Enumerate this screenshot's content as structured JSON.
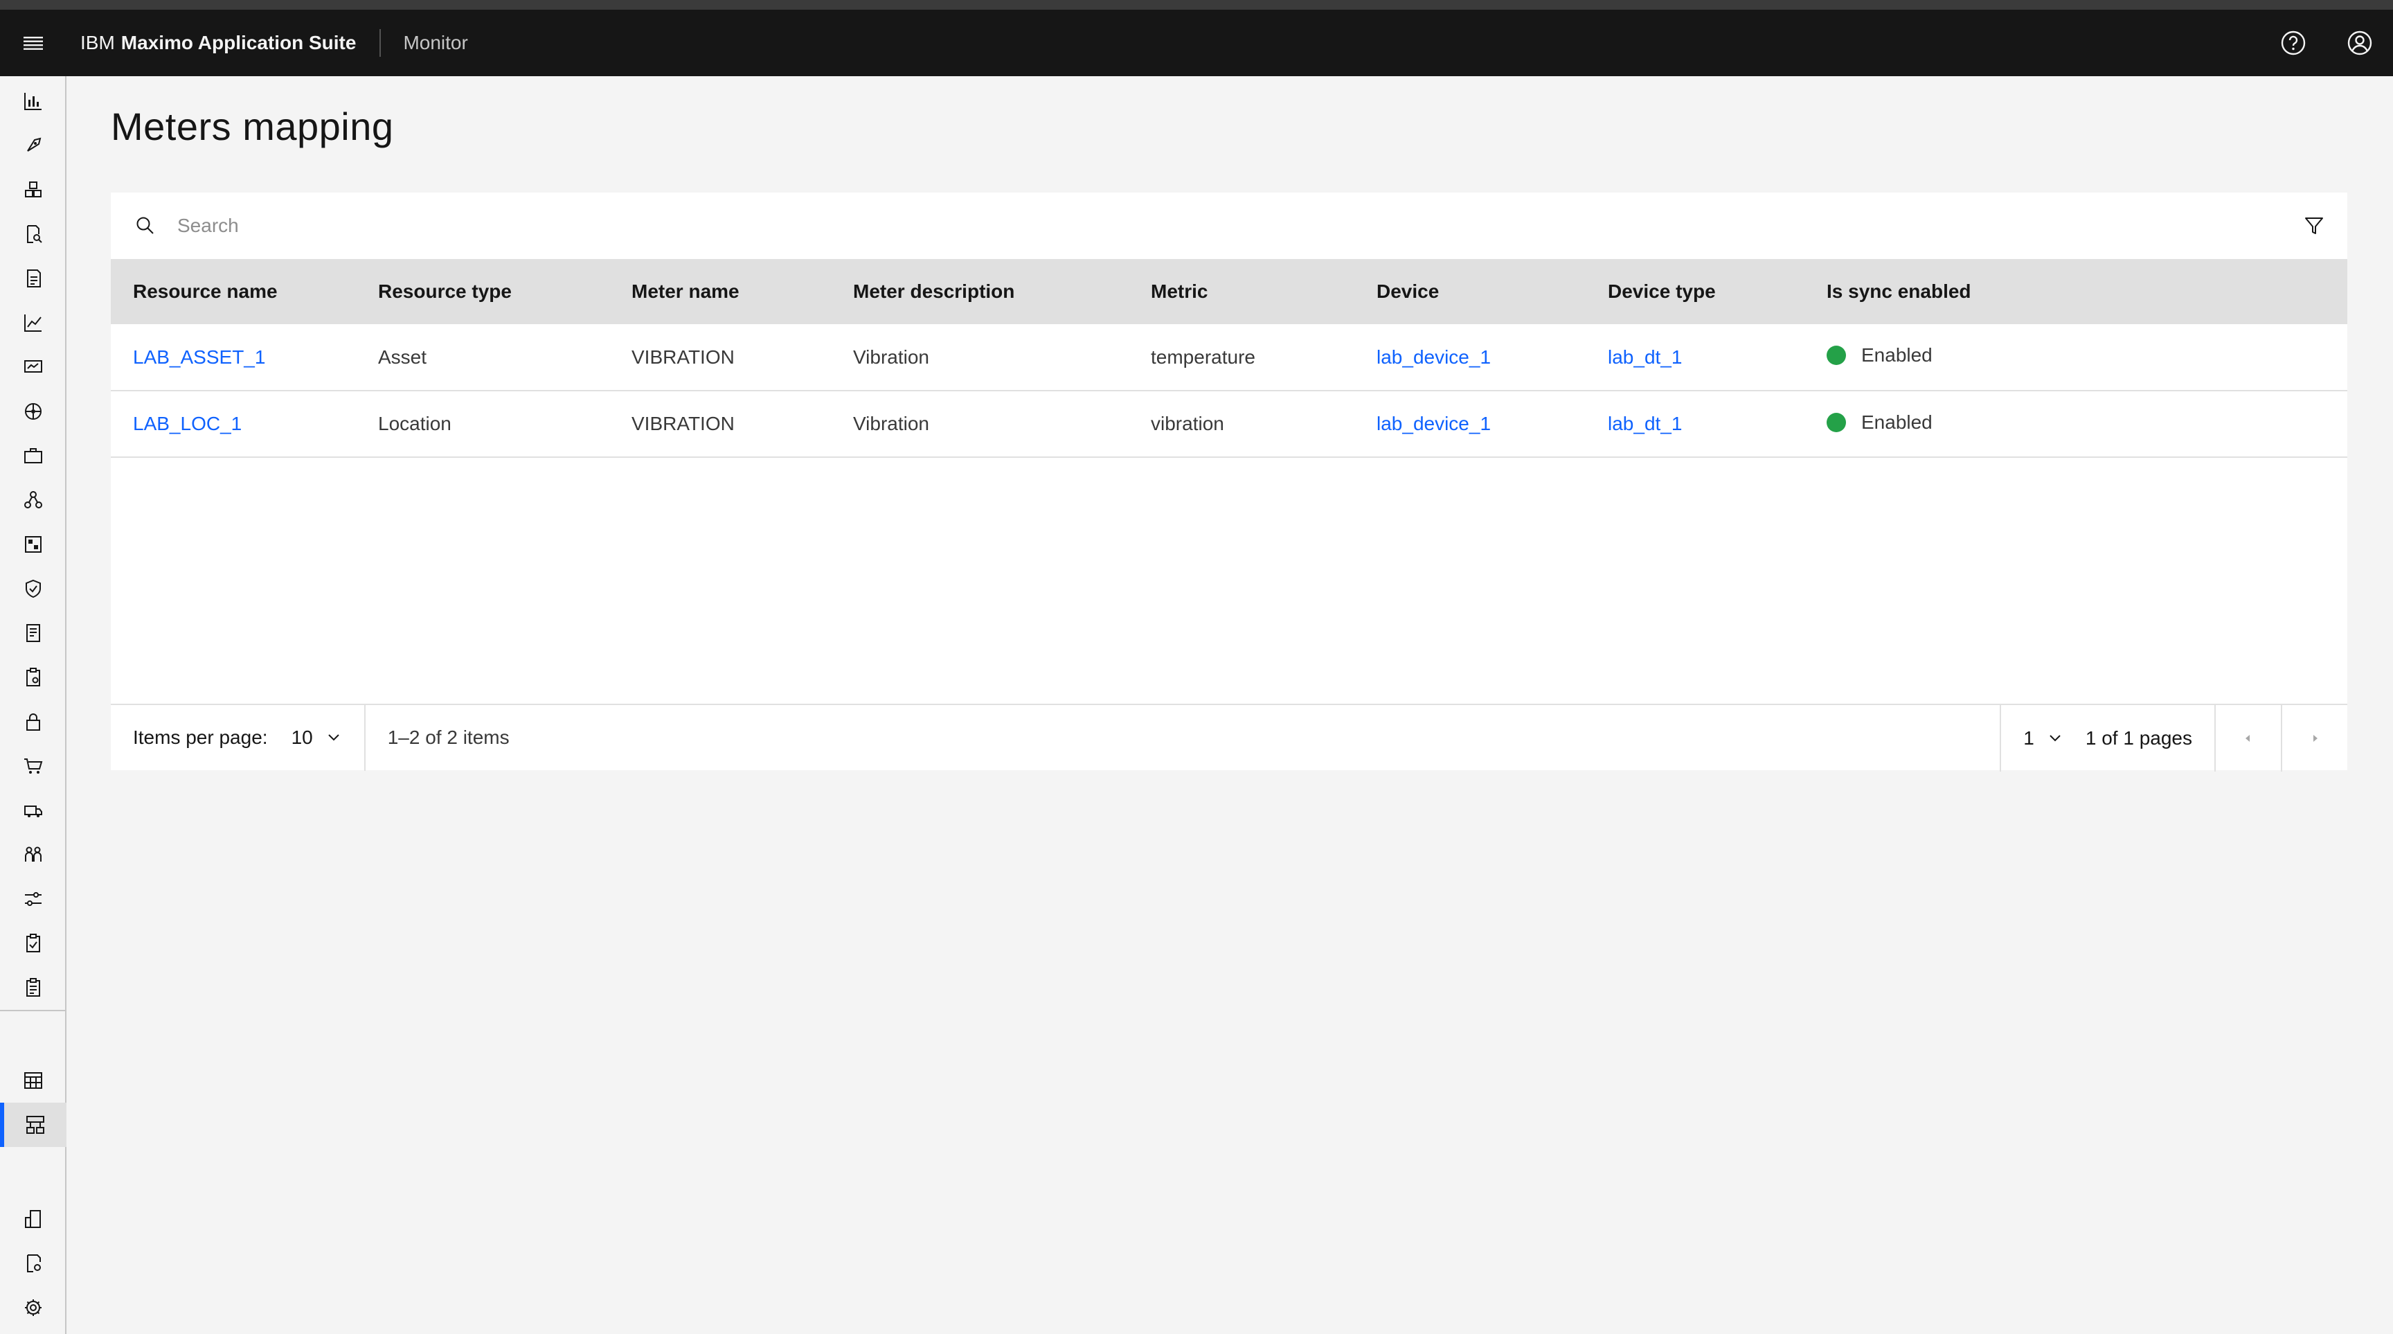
{
  "header": {
    "brand_prefix": "IBM",
    "brand_product": "Maximo Application Suite",
    "app_name": "Monitor",
    "icons": [
      "menu-icon",
      "help-icon",
      "user-avatar-icon"
    ]
  },
  "sidenav": {
    "active_item": "nav-item-meters-mapping",
    "accent_color": "#0f62fe"
  },
  "page": {
    "title": "Meters mapping"
  },
  "search": {
    "placeholder": "Search"
  },
  "table": {
    "columns": [
      "Resource name",
      "Resource type",
      "Meter name",
      "Meter description",
      "Metric",
      "Device",
      "Device type",
      "Is sync enabled"
    ],
    "rows": [
      {
        "resource_name": "LAB_ASSET_1",
        "resource_type": "Asset",
        "meter_name": "VIBRATION",
        "meter_description": "Vibration",
        "metric": "temperature",
        "device": "lab_device_1",
        "device_type": "lab_dt_1",
        "sync": "Enabled"
      },
      {
        "resource_name": "LAB_LOC_1",
        "resource_type": "Location",
        "meter_name": "VIBRATION",
        "meter_description": "Vibration",
        "metric": "vibration",
        "device": "lab_device_1",
        "device_type": "lab_dt_1",
        "sync": "Enabled"
      }
    ],
    "status_color": "#24a148",
    "link_color": "#0f62fe"
  },
  "pagination": {
    "items_per_page_label": "Items per page:",
    "items_per_page_value": "10",
    "range_text": "1–2 of 2 items",
    "current_page": "1",
    "pages_text": "1 of 1 pages"
  }
}
